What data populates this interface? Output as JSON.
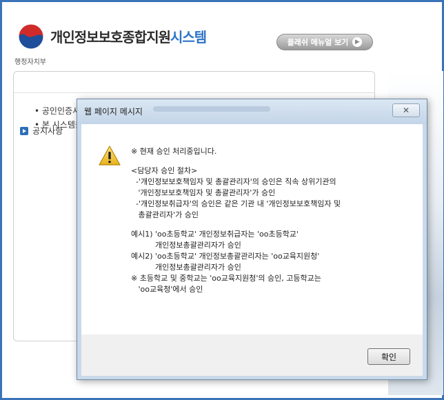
{
  "header": {
    "app_title_main": "개인정보보호종합지원",
    "app_title_accent": "시스템",
    "gov_label": "행정자치부",
    "flash_button": "플래쉬 메뉴얼 보기",
    "flash_button_icon": "chevron-right-icon"
  },
  "background": {
    "items": [
      "• 공인인증서",
      "• 본 시스템을"
    ],
    "notice_label": "공지사항"
  },
  "dialog": {
    "title": "웹 페이지 메시지",
    "close_glyph": "✕",
    "ok_label": "확인",
    "icon": "warning-icon",
    "lines": [
      "※ 현재 승인 처리중입니다.",
      "",
      "<담당자 승인 절차>",
      "  -'개인정보보호책임자 및 총괄관리자'의 승인은 직속 상위기관의",
      "   '개인정보보호책임자 및 총괄관리자'가 승인",
      "  -'개인정보취급자'의 승인은 같은 기관 내 '개인정보보호책임자 및",
      "   총괄관리자'가 승인",
      "",
      "예시1) 'oo초등학교' 개인정보취급자는 'oo초등학교'",
      "          개인정보총괄관리자가 승인",
      "예시2) 'oo초등학교' 개인정보총괄관리자는 'oo교육지원청'",
      "          개인정보총괄관리자가 승인",
      "※ 초등학교 및 중학교는 'oo교육지원청'의 승인, 고등학교는",
      "   'oo교육청'에서 승인"
    ]
  },
  "colors": {
    "accent": "#2c73c9",
    "frame": "#3a73b8",
    "dialog_chrome": "#c9d9ea"
  }
}
